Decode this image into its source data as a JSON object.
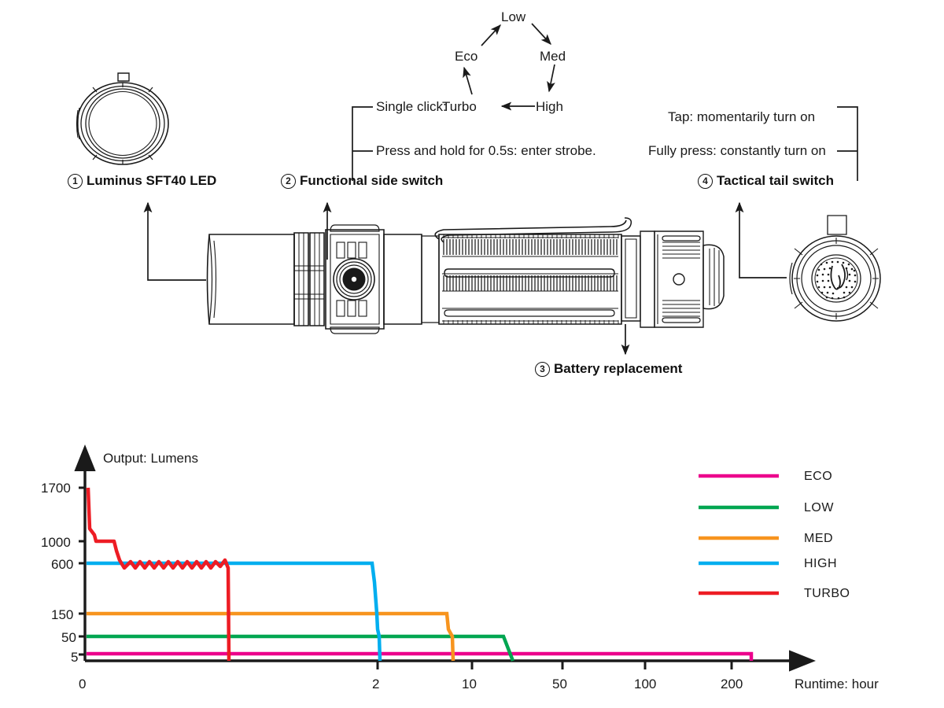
{
  "mode_cycle": {
    "nodes": [
      {
        "id": "eco",
        "label": "Eco"
      },
      {
        "id": "low",
        "label": "Low"
      },
      {
        "id": "med",
        "label": "Med"
      },
      {
        "id": "high",
        "label": "High"
      },
      {
        "id": "turbo",
        "label": "Turbo"
      }
    ],
    "order": "Eco > Low > Med > High > Turbo > Eco"
  },
  "side_switch": {
    "instruction_1_prefix": "Single click:",
    "instruction_1_target": "Turbo",
    "instruction_1_source": "High",
    "instruction_2": "Press and hold for 0.5s: enter strobe."
  },
  "tail_switch": {
    "instruction_1": "Tap: momentarily turn on",
    "instruction_2": "Fully press: constantly turn on"
  },
  "callouts": [
    {
      "num": "1",
      "label": "Luminus SFT40 LED"
    },
    {
      "num": "2",
      "label": "Functional side switch"
    },
    {
      "num": "3",
      "label": "Battery replacement"
    },
    {
      "num": "4",
      "label": "Tactical tail switch"
    }
  ],
  "chart_data": {
    "type": "line",
    "title": "Output: Lumens",
    "xlabel": "Runtime: hour",
    "ylabel": "Output: Lumens",
    "x_scale": "log",
    "y_scale": "custom",
    "x_ticks": [
      "0",
      "2",
      "10",
      "50",
      "100",
      "200"
    ],
    "y_ticks": [
      "1700",
      "1000",
      "600",
      "150",
      "50",
      "5"
    ],
    "grid": false,
    "legend_position": "top-right",
    "series": [
      {
        "name": "ECO",
        "color": "#EC008C",
        "runtime_hours": 210,
        "output_lumens": 5,
        "points": [
          [
            0,
            5
          ],
          [
            210,
            5
          ]
        ]
      },
      {
        "name": "LOW",
        "color": "#00A651",
        "runtime_hours": 22,
        "output_lumens": 50,
        "points": [
          [
            0,
            50
          ],
          [
            20,
            50
          ],
          [
            22,
            5
          ]
        ]
      },
      {
        "name": "MED",
        "color": "#F7941E",
        "runtime_hours": 8,
        "output_lumens": 150,
        "points": [
          [
            0,
            150
          ],
          [
            7,
            150
          ],
          [
            7.5,
            90
          ],
          [
            8,
            50
          ],
          [
            8,
            5
          ]
        ]
      },
      {
        "name": "HIGH",
        "color": "#00AEEF",
        "runtime_hours": 2.2,
        "output_lumens": 600,
        "points": [
          [
            0,
            600
          ],
          [
            2,
            600
          ],
          [
            2.05,
            150
          ],
          [
            2.15,
            50
          ],
          [
            2.2,
            5
          ]
        ]
      },
      {
        "name": "TURBO",
        "color": "#ED1C24",
        "runtime_hours": 1.1,
        "output_lumens": 1700,
        "points": [
          [
            0,
            1700
          ],
          [
            0.08,
            1000
          ],
          [
            0.2,
            1000
          ],
          [
            0.3,
            650
          ],
          [
            1.05,
            650
          ],
          [
            1.1,
            5
          ]
        ],
        "note": "steps down from 1700 to ~1000, then thermal-regulated sawtooth around 650"
      }
    ]
  }
}
